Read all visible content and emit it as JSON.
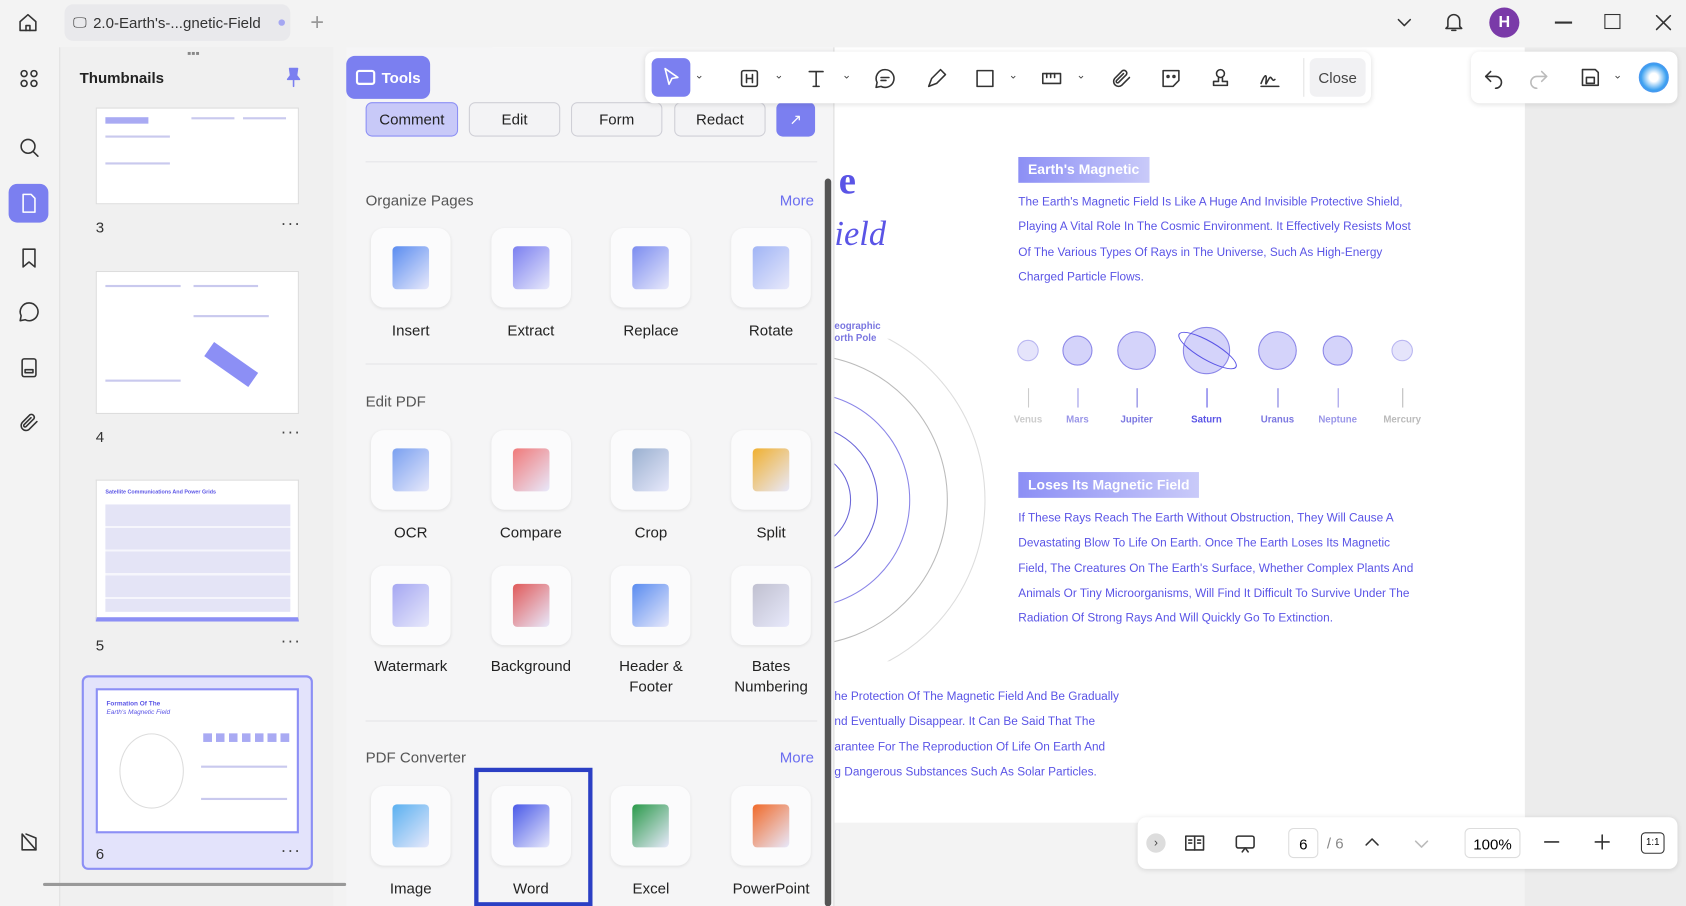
{
  "window": {
    "tab_title": "2.0-Earth's-...gnetic-Field",
    "avatar": "H"
  },
  "thumbnails": {
    "title": "Thumbnails",
    "pages": [
      "3",
      "4",
      "5",
      "6"
    ],
    "more": "···",
    "selected_page": "6",
    "thumb5_title": "Satellite Communications And Power Grids",
    "thumb6_title": "Formation Of The",
    "thumb6_subtitle": "Earth's Magnetic Field"
  },
  "tools": {
    "button": "Tools",
    "tabs": [
      "Comment",
      "Edit",
      "Form",
      "Redact"
    ],
    "organize": {
      "title": "Organize Pages",
      "more": "More",
      "items": [
        "Insert",
        "Extract",
        "Replace",
        "Rotate"
      ]
    },
    "edit": {
      "title": "Edit PDF",
      "items": [
        "OCR",
        "Compare",
        "Crop",
        "Split",
        "Watermark",
        "Background",
        "Header &\nFooter",
        "Bates\nNumbering"
      ]
    },
    "converter": {
      "title": "PDF Converter",
      "more": "More",
      "items": [
        "Image",
        "Word",
        "Excel",
        "PowerPoint"
      ]
    }
  },
  "toolbar": {
    "close": "Close"
  },
  "doc": {
    "title_frag1": "e",
    "title_frag2": "ield",
    "pole_label1": "eographic",
    "pole_label2": "orth Pole",
    "heading1": "Earth's Magnetic",
    "para1": [
      "The Earth's Magnetic Field Is Like A Huge And Invisible Protective Shield,",
      "Playing A Vital Role In The Cosmic Environment. It Effectively Resists Most",
      "Of The Various Types Of Rays in The Universe, Such As High-Energy",
      "Charged Particle Flows."
    ],
    "planets": [
      "Venus",
      "Mars",
      "Jupiter",
      "Saturn",
      "Uranus",
      "Neptune",
      "Mercury"
    ],
    "heading2": "Loses Its Magnetic Field",
    "para2": [
      "If These Rays Reach The Earth Without Obstruction, They Will Cause A",
      "Devastating Blow To Life On Earth. Once The Earth Loses Its Magnetic",
      "Field, The Creatures On The Earth's Surface, Whether Complex Plants And",
      "Animals Or Tiny Microorganisms, Will Find It Difficult To Survive Under The",
      "Radiation Of Strong Rays And Will Quickly Go To Extinction."
    ],
    "para3": [
      "he Protection Of The Magnetic Field And Be Gradually",
      "nd Eventually Disappear. It Can Be Said That The",
      "arantee For The Reproduction Of Life On Earth And",
      "g Dangerous Substances Such As Solar Particles."
    ]
  },
  "bottom": {
    "page": "6",
    "total": "/ 6",
    "zoom": "100%",
    "fit": "1:1"
  },
  "colors": {
    "accent": "#7b7ff0",
    "text_purple": "#5a54e6"
  }
}
